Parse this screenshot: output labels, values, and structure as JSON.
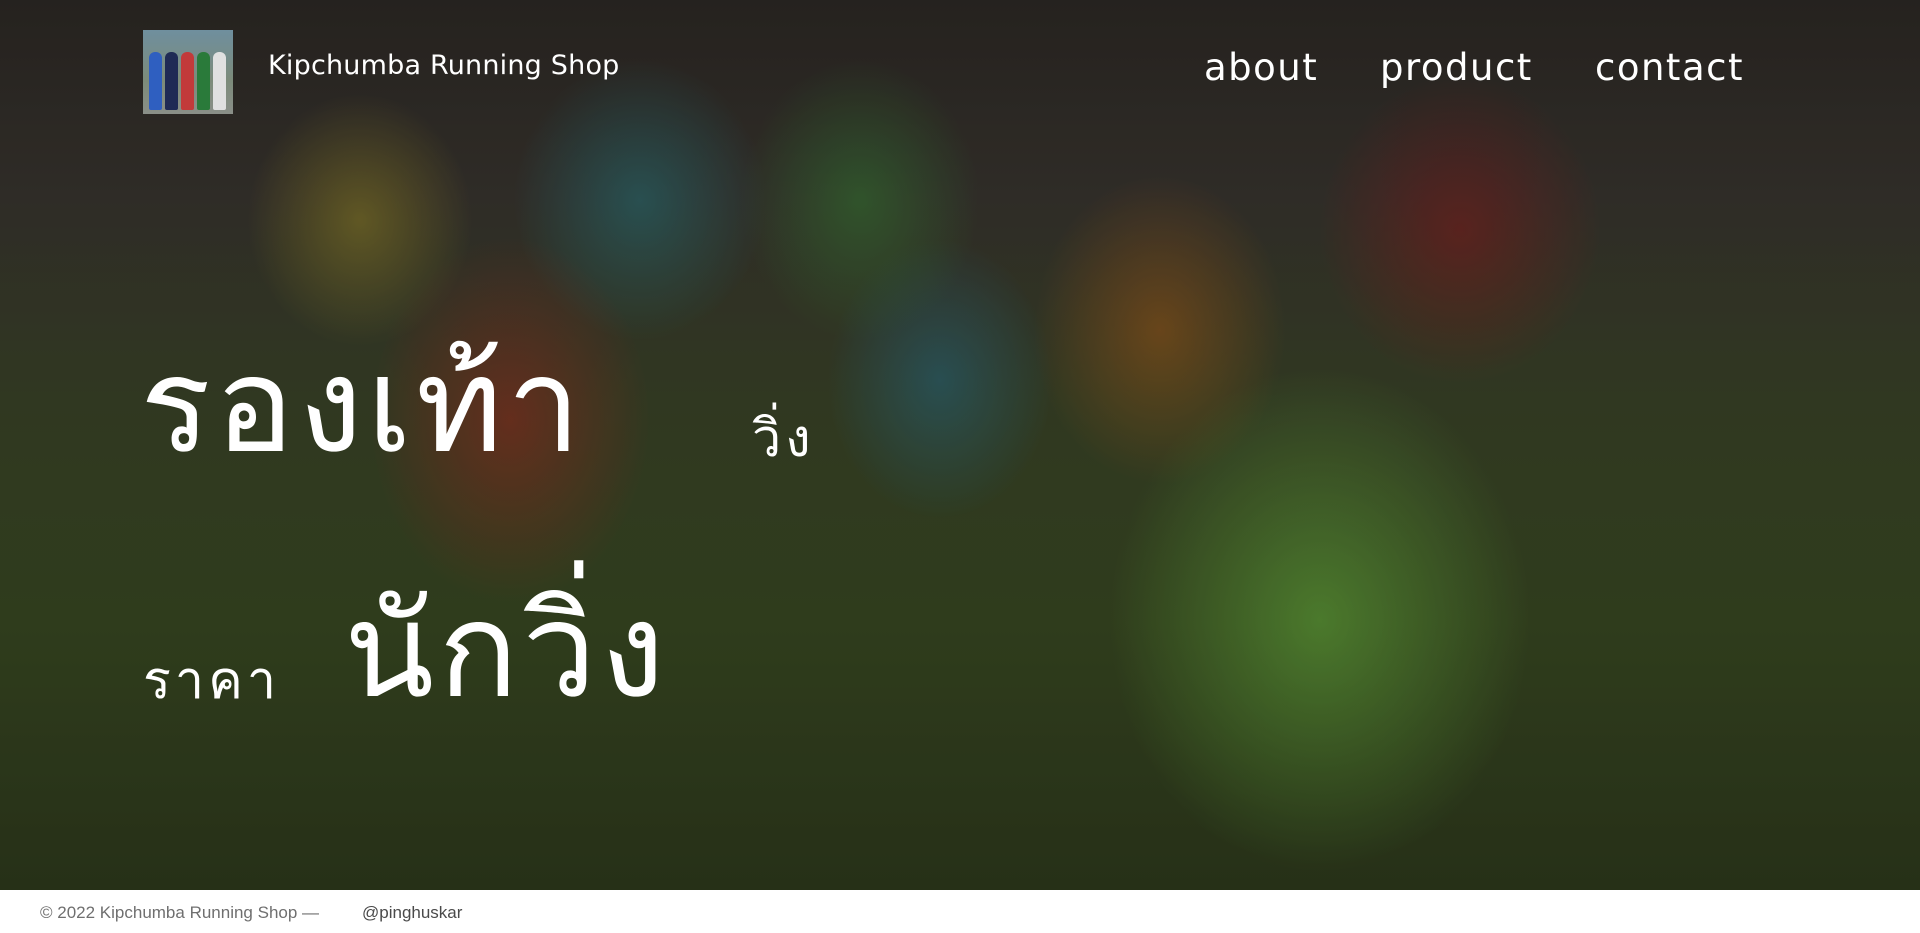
{
  "header": {
    "brand": "Kipchumba Running Shop",
    "nav": [
      {
        "label": "about"
      },
      {
        "label": "product"
      },
      {
        "label": "contact"
      }
    ]
  },
  "hero": {
    "line1_big": "รองเท้า",
    "line1_small": "วิ่ง",
    "line2_small": "ราคา",
    "line2_big": "นักวิ่ง"
  },
  "footer": {
    "copyright": "© 2022 Kipchumba Running Shop —",
    "handle": "@pinghuskar"
  }
}
